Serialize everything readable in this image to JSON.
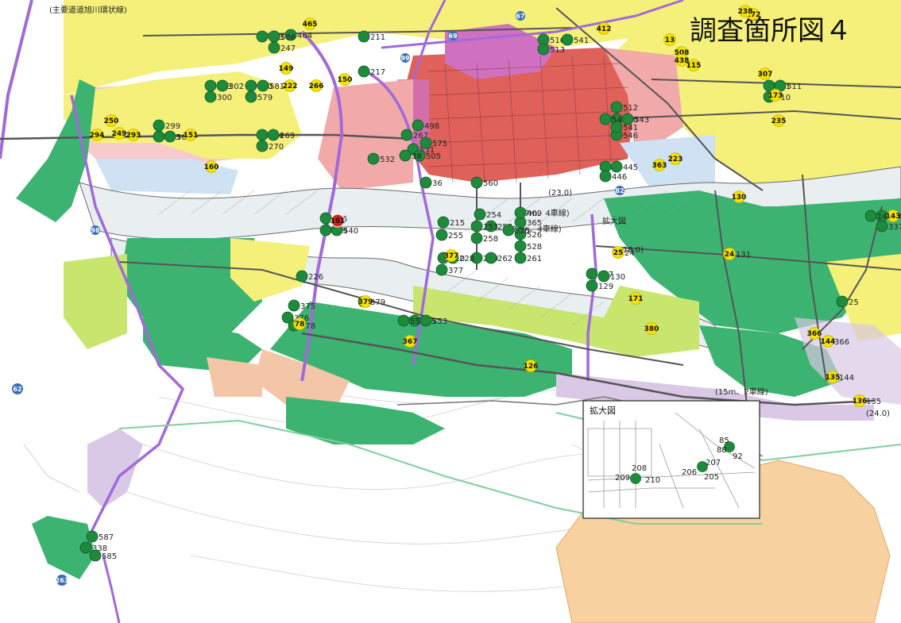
{
  "title": "調査箇所図４",
  "inset": {
    "title": "拡大図",
    "labels": [
      "208",
      "209",
      "210",
      "206",
      "205",
      "207",
      "85",
      "88",
      "92"
    ]
  },
  "callout_label": "拡大図",
  "road_routes": [
    "62",
    "263",
    "98",
    "99",
    "67",
    "69",
    "82"
  ],
  "green_points": [
    "51",
    "247",
    "243",
    "464",
    "211",
    "217",
    "516",
    "513",
    "541",
    "303",
    "302",
    "300",
    "580",
    "579",
    "581",
    "583",
    "299",
    "562",
    "564",
    "270",
    "269",
    "267",
    "531",
    "505",
    "498",
    "575",
    "38",
    "532",
    "560",
    "561",
    "510",
    "511",
    "512",
    "440",
    "547",
    "543",
    "546",
    "541",
    "33",
    "445",
    "446",
    "36",
    "536",
    "539",
    "540",
    "215",
    "255",
    "254",
    "252",
    "253",
    "258",
    "259",
    "262",
    "261",
    "528",
    "526",
    "525",
    "365",
    "409",
    "410",
    "228",
    "377",
    "226",
    "375",
    "376",
    "378",
    "379",
    "545",
    "552",
    "553",
    "127",
    "129",
    "130",
    "131",
    "24",
    "25",
    "366",
    "144",
    "135",
    "136",
    "143",
    "337",
    "338",
    "587",
    "585",
    "586"
  ],
  "yellow_points": [
    "465",
    "149",
    "266",
    "150",
    "222",
    "250",
    "249",
    "293",
    "294",
    "151",
    "160",
    "13",
    "508",
    "438",
    "115",
    "307",
    "173",
    "235",
    "223",
    "363",
    "172",
    "238",
    "412",
    "24",
    "25",
    "171",
    "380",
    "379",
    "367",
    "126",
    "130",
    "135",
    "136",
    "143",
    "144",
    "366",
    "78",
    "377"
  ],
  "red_point": "161",
  "road_notes": [
    "(主要道道旭川環状線)",
    "(15m、2車線)",
    "(27m、4車線)",
    "(18.0)",
    "(21m、4車線)",
    "(23.0)",
    "(24.0)"
  ],
  "colors": {
    "residential_green": "#3cb371",
    "residential_light": "#c8e66e",
    "yellow_zone": "#f5f07a",
    "commercial_pink": "#f2a9a9",
    "commercial_red": "#e0605a",
    "commercial_purple": "#d070c0",
    "industrial_blue": "#cfe2f3",
    "river": "#e9eef0",
    "salmon": "#f4c6a8",
    "lavender": "#d9c8e6",
    "orange_zone": "#f7d2a0",
    "road_purple": "#a16ad9",
    "point_green": "#1f8a3c",
    "point_yellow": "#f4e300",
    "point_red": "#e0191f",
    "route_blue": "#3a6db4"
  }
}
